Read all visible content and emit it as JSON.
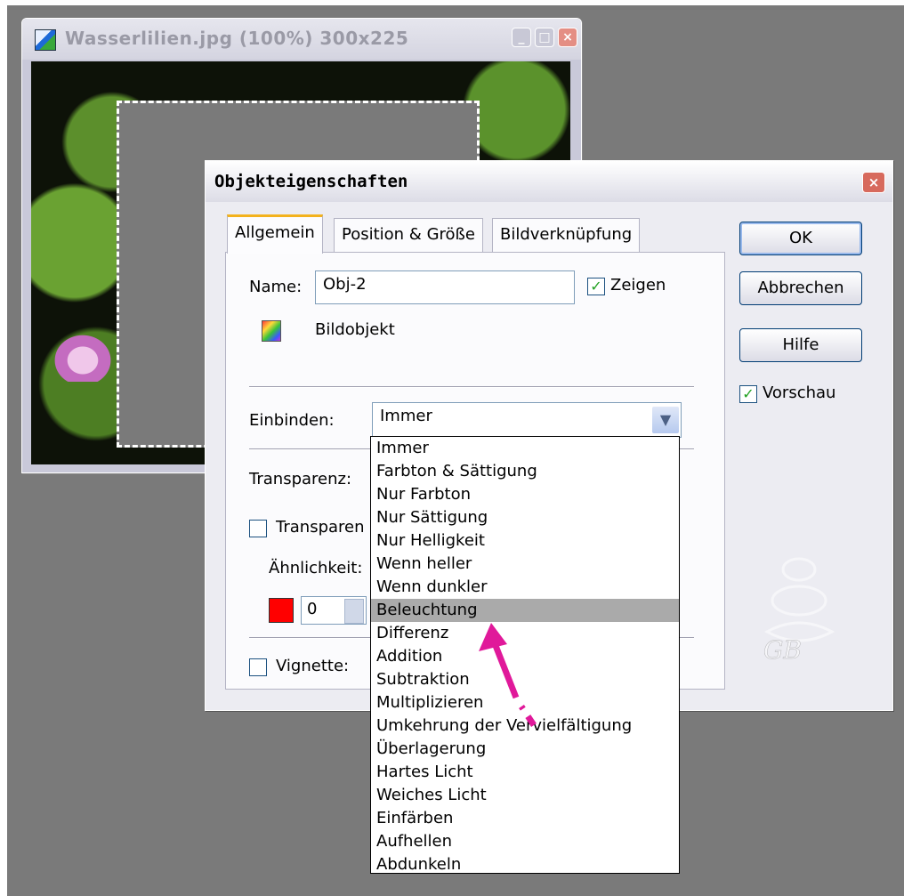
{
  "image_window": {
    "title": "Wasserlilien.jpg (100%) 300x225",
    "buttons": [
      "minimize",
      "maximize",
      "close"
    ]
  },
  "dialog": {
    "title": "Objekteigenschaften",
    "tabs": [
      "Allgemein",
      "Position & Größe",
      "Bildverknüpfung"
    ],
    "name_label": "Name:",
    "name_value": "Obj-2",
    "show_label": "Zeigen",
    "show_checked": true,
    "object_type": "Bildobjekt",
    "embed_label": "Einbinden:",
    "embed_value": "Immer",
    "transparency_label": "Transparenz:",
    "transparent_label": "Transparen",
    "similarity_label": "Ähnlichkeit:",
    "spinner_value": "0",
    "vignette_label": "Vignette:",
    "buttons": {
      "ok": "OK",
      "cancel": "Abbrechen",
      "help": "Hilfe"
    },
    "preview_label": "Vorschau",
    "preview_checked": true
  },
  "blend_modes": {
    "selected": "Beleuchtung",
    "options": [
      "Immer",
      "Farbton & Sättigung",
      "Nur Farbton",
      "Nur Sättigung",
      "Nur Helligkeit",
      "Wenn heller",
      "Wenn dunkler",
      "Beleuchtung",
      "Differenz",
      "Addition",
      "Subtraktion",
      "Multiplizieren",
      "Umkehrung der Vervielfältigung",
      "Überlagerung",
      "Hartes Licht",
      "Weiches Licht",
      "Einfärben",
      "Aufhellen",
      "Abdunkeln"
    ]
  },
  "colors": {
    "accent_tab": "#f3b21d",
    "arrow": "#e0199a",
    "swatch": "#ff0000"
  }
}
